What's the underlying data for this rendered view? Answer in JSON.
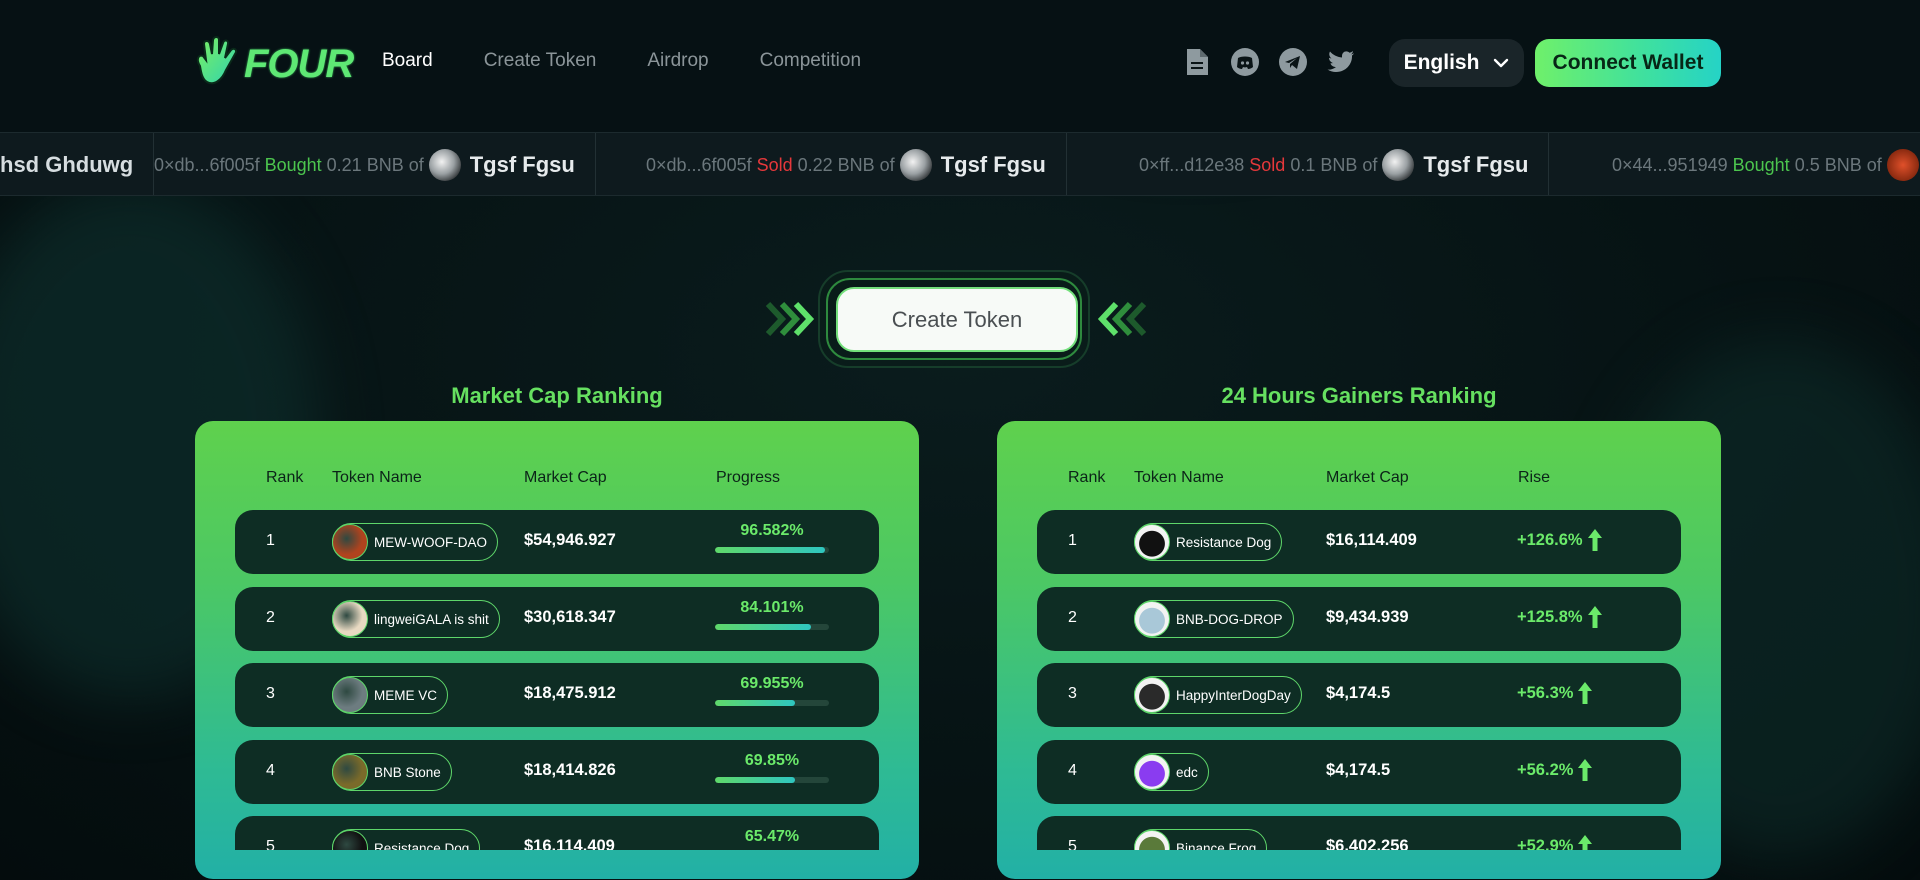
{
  "header": {
    "brand": "FOUR",
    "nav": [
      {
        "label": "Board",
        "active": true
      },
      {
        "label": "Create Token",
        "active": false
      },
      {
        "label": "Airdrop",
        "active": false
      },
      {
        "label": "Competition",
        "active": false
      }
    ],
    "socials": [
      "document-icon",
      "discord-icon",
      "telegram-icon",
      "twitter-icon"
    ],
    "language": "English",
    "connect_label": "Connect Wallet"
  },
  "ticker": [
    {
      "prefix": "",
      "action": "",
      "amount": "",
      "token": "hsd Ghduwg"
    },
    {
      "prefix": "0×db...6f005f",
      "action": "Bought",
      "amount": "0.21 BNB of",
      "token": "Tgsf Fgsu"
    },
    {
      "prefix": "0×db...6f005f",
      "action": "Sold",
      "amount": "0.22 BNB of",
      "token": "Tgsf Fgsu"
    },
    {
      "prefix": "0×ff...d12e38",
      "action": "Sold",
      "amount": "0.1 BNB of",
      "token": "Tgsf Fgsu"
    },
    {
      "prefix": "0×44...951949",
      "action": "Bought",
      "amount": "0.5 BNB of",
      "token": ""
    }
  ],
  "create_token_label": "Create Token",
  "market_cap": {
    "title": "Market Cap Ranking",
    "headers": {
      "rank": "Rank",
      "name": "Token Name",
      "cap": "Market Cap",
      "last": "Progress"
    },
    "rows": [
      {
        "rank": "1",
        "name": "MEW-WOOF-DAO",
        "cap": "$54,946.927",
        "pct": "96.582%",
        "progress": 0.96582,
        "avatar": "#b0431e"
      },
      {
        "rank": "2",
        "name": "lingweiGALA is shit",
        "cap": "$30,618.347",
        "pct": "84.101%",
        "progress": 0.84101,
        "avatar": "#e8d9c2"
      },
      {
        "rank": "3",
        "name": "MEME VC",
        "cap": "$18,475.912",
        "pct": "69.955%",
        "progress": 0.69955,
        "avatar": "#6d7c80"
      },
      {
        "rank": "4",
        "name": "BNB Stone",
        "cap": "$18,414.826",
        "pct": "69.85%",
        "progress": 0.6985,
        "avatar": "#7a6a2a"
      },
      {
        "rank": "5",
        "name": "Resistance Dog",
        "cap": "$16,114.409",
        "pct": "65.47%",
        "progress": 0.6547,
        "avatar": "#111111"
      }
    ]
  },
  "gainers": {
    "title": "24 Hours Gainers Ranking",
    "headers": {
      "rank": "Rank",
      "name": "Token Name",
      "cap": "Market Cap",
      "last": "Rise"
    },
    "rows": [
      {
        "rank": "1",
        "name": "Resistance Dog",
        "cap": "$16,114.409",
        "rise": "+126.6%",
        "avatar": "#111111"
      },
      {
        "rank": "2",
        "name": "BNB-DOG-DROP",
        "cap": "$9,434.939",
        "rise": "+125.8%",
        "avatar": "#a9c8d8"
      },
      {
        "rank": "3",
        "name": "HappyInterDogDay",
        "cap": "$4,174.5",
        "rise": "+56.3%",
        "avatar": "#2a2a2a"
      },
      {
        "rank": "4",
        "name": "edc",
        "cap": "$4,174.5",
        "rise": "+56.2%",
        "avatar": "#8a3cf0"
      },
      {
        "rank": "5",
        "name": "Binance Frog",
        "cap": "$6,402.256",
        "rise": "+52.9%",
        "avatar": "#5a7a3a"
      }
    ]
  },
  "colors": {
    "accent": "#5ee874",
    "buy": "#4cc54e",
    "sell": "#e5383b"
  }
}
